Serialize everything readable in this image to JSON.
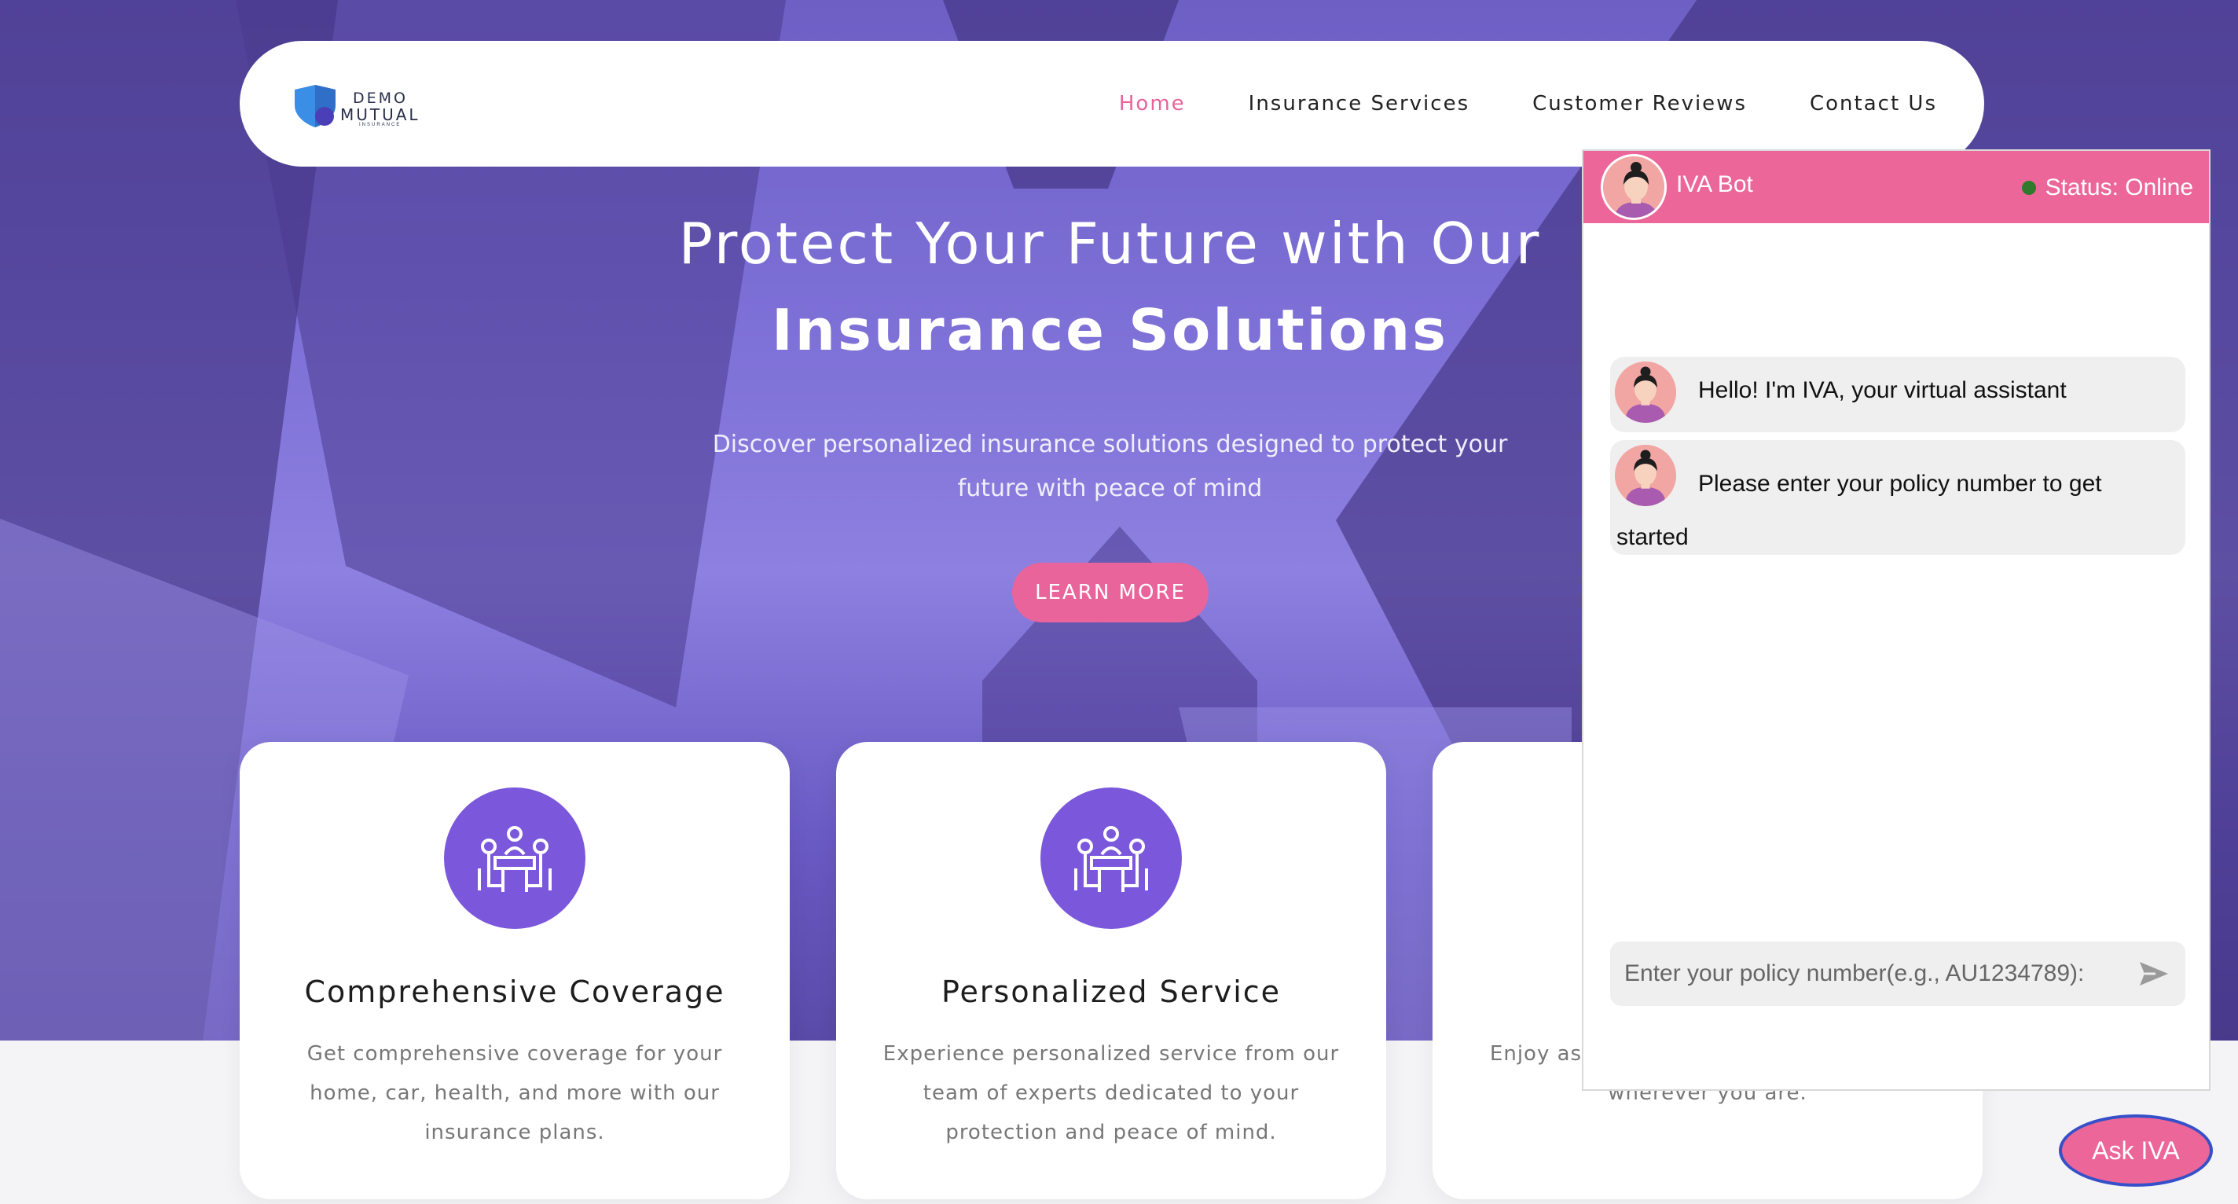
{
  "brand": {
    "line1": "DEMO",
    "line2": "MUTUAL",
    "line3": "INSURANCE"
  },
  "nav": [
    {
      "label": "Home",
      "active": true
    },
    {
      "label": "Insurance Services"
    },
    {
      "label": "Customer Reviews"
    },
    {
      "label": "Contact Us"
    }
  ],
  "hero": {
    "title_line1": "Protect Your Future with Our",
    "title_line2": "Insurance Solutions",
    "subtitle": "Discover personalized insurance solutions designed to protect your future with peace of mind",
    "cta": "LEARN MORE"
  },
  "features": [
    {
      "title": "Comprehensive Coverage",
      "text": "Get comprehensive coverage for your home, car, health, and more with our insurance plans."
    },
    {
      "title": "Personalized Service",
      "text": "Experience personalized service from our team of experts dedicated to your protection and peace of mind."
    },
    {
      "title": "",
      "text": "Enjoy assistance whenever you need it, wherever you are."
    }
  ],
  "chat": {
    "bot_name": "IVA Bot",
    "status": "Status: Online",
    "messages": [
      "Hello! I'm IVA, your virtual assistant",
      "Please enter your policy number to get started"
    ],
    "input_placeholder": "Enter your policy number(e.g., AU1234789):"
  },
  "ask_button": "Ask IVA",
  "colors": {
    "accent": "#e8649b",
    "icon_bg": "#7b57dc",
    "status_dot": "#2f7a2c"
  }
}
